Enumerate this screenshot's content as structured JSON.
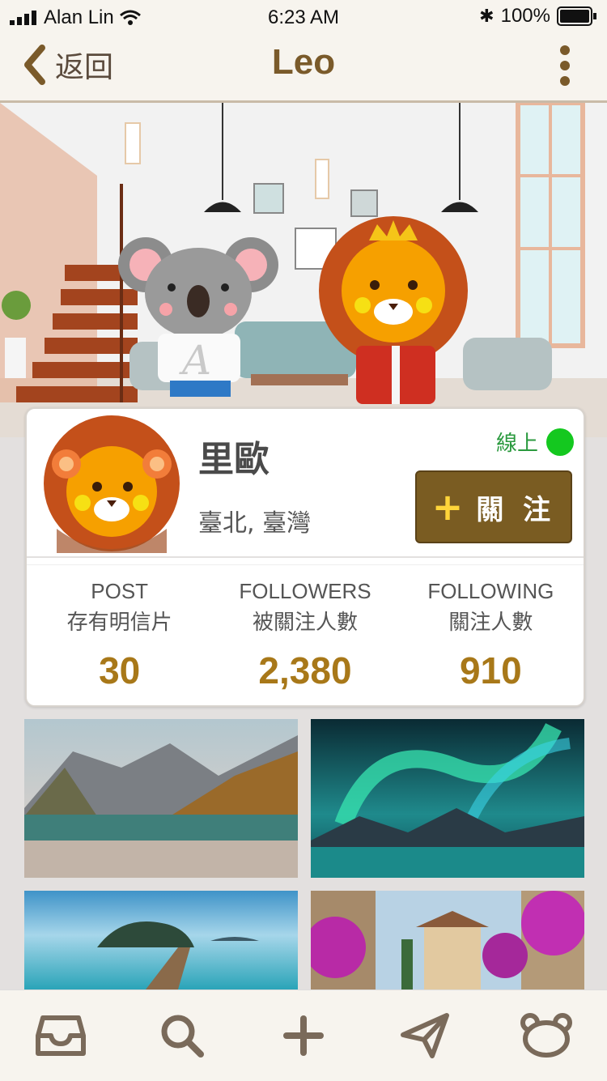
{
  "status": {
    "carrier": "Alan Lin",
    "time": "6:23 AM",
    "battery": "100%"
  },
  "nav": {
    "back_label": "返回",
    "title": "Leo"
  },
  "profile": {
    "name": "里歐",
    "location": "臺北, 臺灣",
    "online_label": "線上",
    "follow_label": "關 注",
    "follow_plus": "+"
  },
  "stats": [
    {
      "en": "POST",
      "zh": "存有明信片",
      "value": "30"
    },
    {
      "en": "FOLLOWERS",
      "zh": "被關注人數",
      "value": "2,380"
    },
    {
      "en": "FOLLOWING",
      "zh": "關注人數",
      "value": "910"
    }
  ],
  "tabs": [
    "inbox-icon",
    "search-icon",
    "add-icon",
    "send-icon",
    "bear-icon"
  ],
  "colors": {
    "brand": "#7a5a2a",
    "accent": "#a87819",
    "online": "#14c81f",
    "follow_bg": "#7a5c22"
  }
}
